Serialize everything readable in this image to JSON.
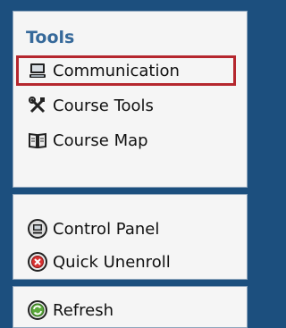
{
  "tools": {
    "title": "Tools",
    "items": [
      {
        "label": "Communication",
        "icon": "computer-icon",
        "selected": true
      },
      {
        "label": "Course Tools",
        "icon": "tools-icon"
      },
      {
        "label": "Course Map",
        "icon": "map-book-icon"
      }
    ]
  },
  "admin": {
    "items": [
      {
        "label": "Control Panel",
        "icon": "control-panel-icon"
      },
      {
        "label": "Quick Unenroll",
        "icon": "unenroll-icon"
      }
    ]
  },
  "refresh": {
    "label": "Refresh",
    "icon": "refresh-icon"
  },
  "colors": {
    "frame": "#1c4f7e",
    "title": "#36699a",
    "selection_border": "#b5272e",
    "panel_bg": "#f5f5f5"
  }
}
